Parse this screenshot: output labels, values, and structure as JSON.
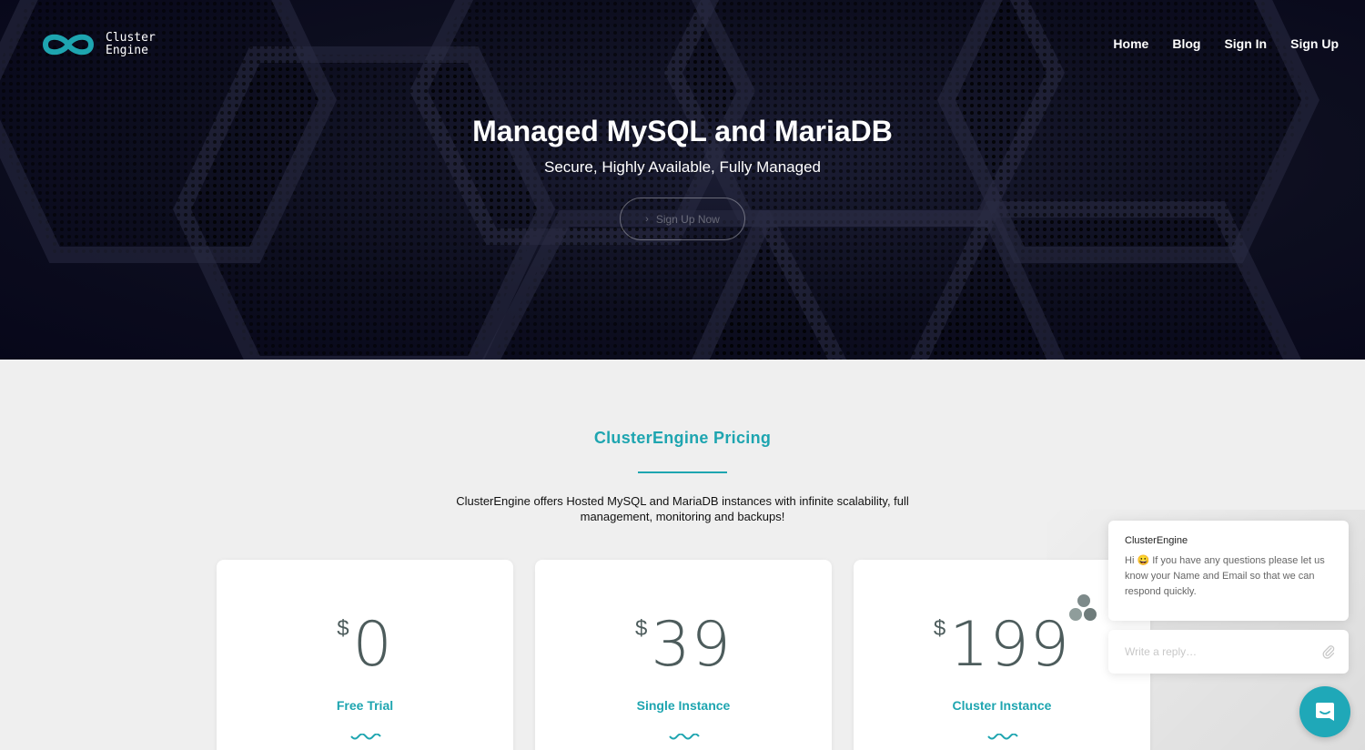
{
  "brand": {
    "line1": "Cluster",
    "line2": "Engine",
    "color": "#1ea5b0"
  },
  "nav": {
    "items": [
      {
        "label": "Home"
      },
      {
        "label": "Blog"
      },
      {
        "label": "Sign In"
      },
      {
        "label": "Sign Up"
      }
    ]
  },
  "hero": {
    "title": "Managed MySQL and MariaDB",
    "subtitle": "Secure, Highly Available, Fully Managed",
    "cta_label": "Sign Up Now",
    "cta_icon": "chevron-right-icon"
  },
  "pricing": {
    "title": "ClusterEngine Pricing",
    "description": "ClusterEngine offers Hosted MySQL and MariaDB instances with infinite scalability, full management, monitoring and backups!",
    "plans": [
      {
        "currency": "$",
        "price": "0",
        "name": "Free Trial"
      },
      {
        "currency": "$",
        "price": "39",
        "name": "Single Instance"
      },
      {
        "currency": "$",
        "price": "199",
        "name": "Cluster Instance"
      }
    ]
  },
  "chat": {
    "sender": "ClusterEngine",
    "message": "Hi 😀 If you have any questions please let us know your Name and Email so that we can respond quickly.",
    "reply_placeholder": "Write a reply…",
    "launcher_icon": "chat-bubble-icon",
    "accent": "#1fa8b8"
  }
}
